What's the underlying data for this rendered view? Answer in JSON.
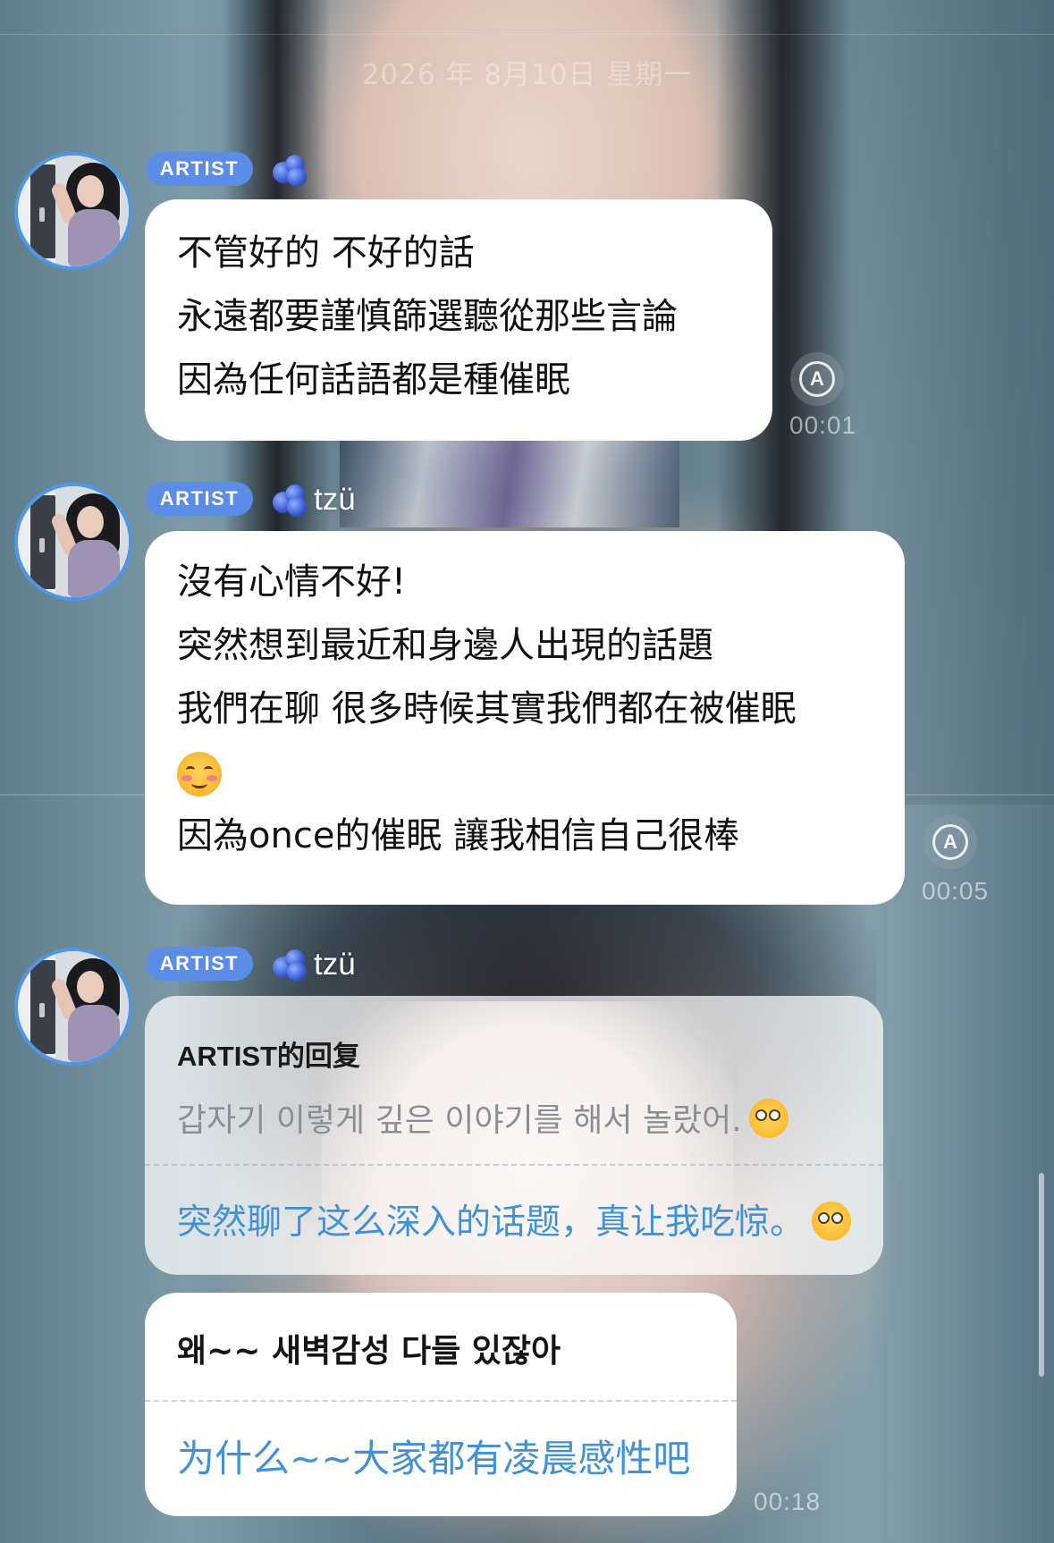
{
  "date": "2026 年 8月10日 星期一",
  "messages": [
    {
      "badge": "ARTIST",
      "nickname": "",
      "lines": [
        "不管好的 不好的話",
        "永遠都要謹慎篩選聽從那些言論",
        "因為任何話語都是種催眠"
      ],
      "translate_icon": "A",
      "time": "00:01"
    },
    {
      "badge": "ARTIST",
      "nickname": "tzü",
      "lines": [
        "沒有心情不好!",
        "突然想到最近和身邊人出現的話題",
        "我們在聊 很多時候其實我們都在被催眠",
        "☺️",
        "因為once的催眠 讓我相信自己很棒"
      ],
      "translate_icon": "A",
      "time": "00:05"
    },
    {
      "badge": "ARTIST",
      "nickname": "tzü",
      "reply_title": "ARTIST的回复",
      "reply_original": "갑자기 이렇게 깊은 이야기를 해서 놀랐어.",
      "reply_translation": "突然聊了这么深入的话题，真让我吃惊。"
    },
    {
      "korean": "왜~~ 새벽감성 다들 있잖아",
      "translation": "为什么~~大家都有凌晨感性吧",
      "time": "00:18"
    }
  ],
  "icons": {
    "avatar": "avatar-photo",
    "nick_emblem": "blueberry-icon",
    "translate": "translate-icon",
    "flushed": "flushed-face-emoji",
    "smile": "smiling-face-emoji"
  },
  "colors": {
    "badge": "#5b8de6",
    "avatar_ring": "#4f97e6",
    "translation_text": "#3f91d9"
  }
}
